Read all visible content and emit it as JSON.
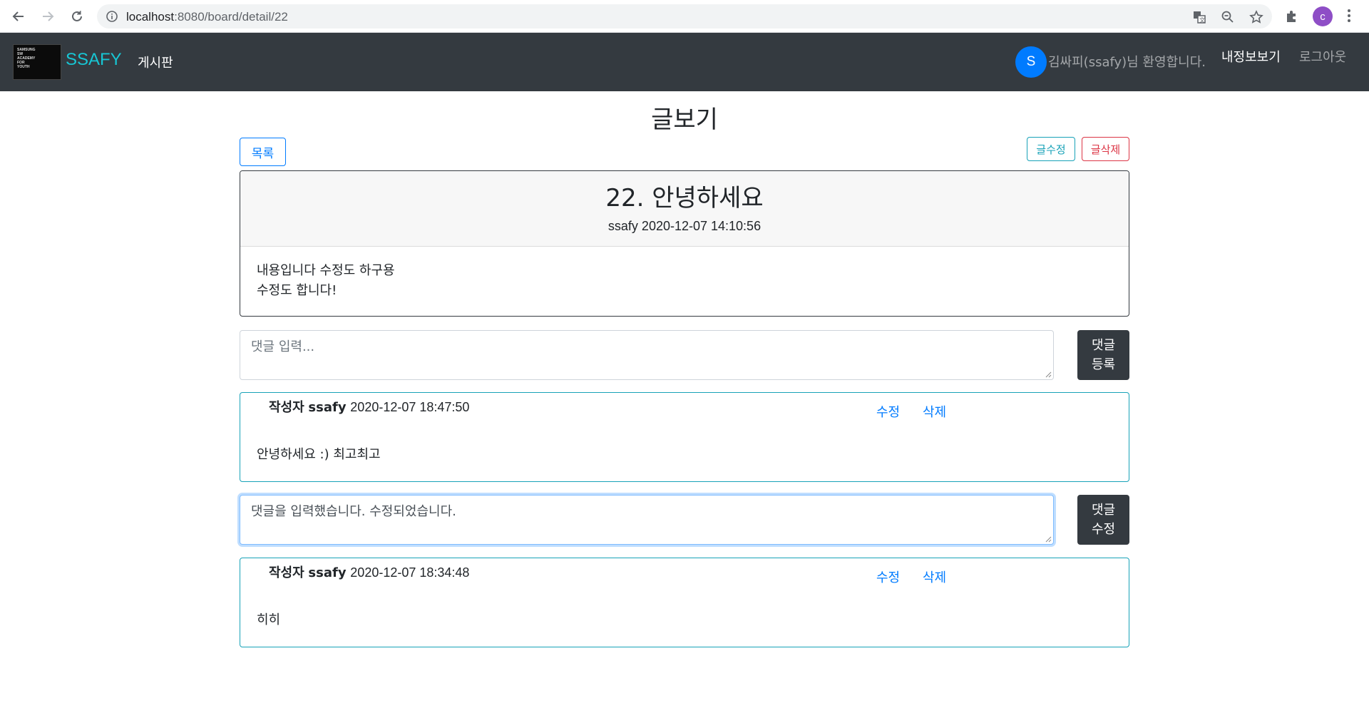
{
  "browser": {
    "url_host": "localhost",
    "url_rest": ":8080/board/detail/22",
    "profile_initial": "c"
  },
  "navbar": {
    "brand": "SSAFY",
    "logo_lines": [
      "SAMSUNG",
      "SW",
      "ACADEMY",
      "FOR",
      "YOUTH"
    ],
    "board_link": "게시판",
    "user_initial": "S",
    "welcome": "김싸피(ssafy)님 환영합니다.",
    "myinfo_link": "내정보보기",
    "logout_link": "로그아웃"
  },
  "page": {
    "title": "글보기",
    "list_button": "목록",
    "edit_button": "글수정",
    "delete_button": "글삭제"
  },
  "article": {
    "title": "22. 안녕하세요",
    "meta": "ssafy 2020-12-07 14:10:56",
    "body_lines": [
      "내용입니다 수정도 하구용",
      "수정도 합니다!"
    ]
  },
  "comment_form": {
    "placeholder": "댓글 입력...",
    "submit_line1": "댓글",
    "submit_line2": "등록"
  },
  "comments": [
    {
      "author_label": "작성자",
      "author": "ssafy",
      "date": "2020-12-07 18:47:50",
      "edit_label": "수정",
      "delete_label": "삭제",
      "text": "안녕하세요 :) 최고최고"
    },
    {
      "author_label": "작성자",
      "author": "ssafy",
      "date": "2020-12-07 18:34:48",
      "edit_label": "수정",
      "delete_label": "삭제",
      "text": "히히"
    }
  ],
  "edit_form": {
    "value": "댓글을 입력했습니다. 수정되었습니다.",
    "submit_line1": "댓글",
    "submit_line2": "수정"
  }
}
